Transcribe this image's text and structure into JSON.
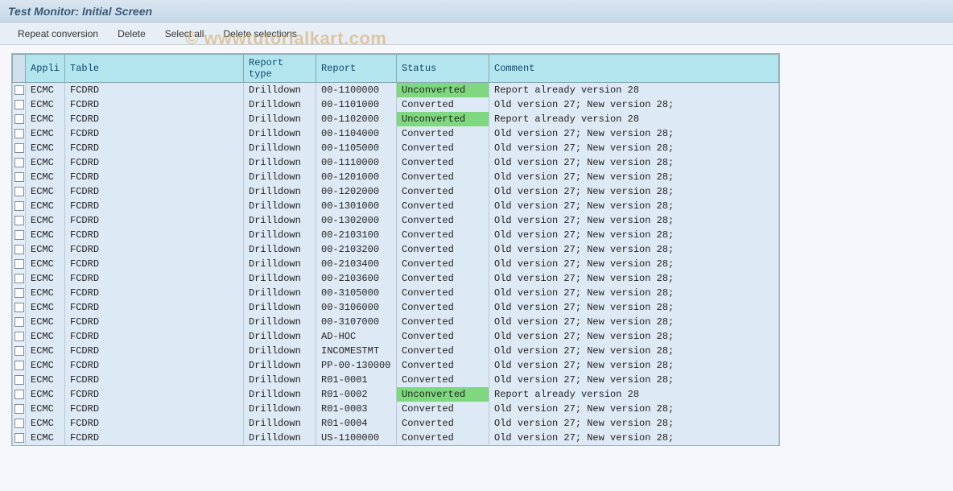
{
  "title": "Test Monitor: Initial Screen",
  "toolbar": {
    "repeat": "Repeat conversion",
    "delete": "Delete",
    "selectall": "Select all",
    "delsel": "Delete selections"
  },
  "watermark": "© wwwtutorialkart.com",
  "columns": {
    "appli": "Appli",
    "table": "Table",
    "reptype": "Report type",
    "report": "Report",
    "status": "Status",
    "comment": "Comment"
  },
  "rows": [
    {
      "appli": "ECMC",
      "table": "FCDRD",
      "reptype": "Drilldown",
      "report": "00-1100000",
      "status": "Unconverted",
      "comment": "Report already version 28"
    },
    {
      "appli": "ECMC",
      "table": "FCDRD",
      "reptype": "Drilldown",
      "report": "00-1101000",
      "status": "Converted",
      "comment": "Old version 27; New version 28;"
    },
    {
      "appli": "ECMC",
      "table": "FCDRD",
      "reptype": "Drilldown",
      "report": "00-1102000",
      "status": "Unconverted",
      "comment": "Report already version 28"
    },
    {
      "appli": "ECMC",
      "table": "FCDRD",
      "reptype": "Drilldown",
      "report": "00-1104000",
      "status": "Converted",
      "comment": "Old version 27; New version 28;"
    },
    {
      "appli": "ECMC",
      "table": "FCDRD",
      "reptype": "Drilldown",
      "report": "00-1105000",
      "status": "Converted",
      "comment": "Old version 27; New version 28;"
    },
    {
      "appli": "ECMC",
      "table": "FCDRD",
      "reptype": "Drilldown",
      "report": "00-1110000",
      "status": "Converted",
      "comment": "Old version 27; New version 28;"
    },
    {
      "appli": "ECMC",
      "table": "FCDRD",
      "reptype": "Drilldown",
      "report": "00-1201000",
      "status": "Converted",
      "comment": "Old version 27; New version 28;"
    },
    {
      "appli": "ECMC",
      "table": "FCDRD",
      "reptype": "Drilldown",
      "report": "00-1202000",
      "status": "Converted",
      "comment": "Old version 27; New version 28;"
    },
    {
      "appli": "ECMC",
      "table": "FCDRD",
      "reptype": "Drilldown",
      "report": "00-1301000",
      "status": "Converted",
      "comment": "Old version 27; New version 28;"
    },
    {
      "appli": "ECMC",
      "table": "FCDRD",
      "reptype": "Drilldown",
      "report": "00-1302000",
      "status": "Converted",
      "comment": "Old version 27; New version 28;"
    },
    {
      "appli": "ECMC",
      "table": "FCDRD",
      "reptype": "Drilldown",
      "report": "00-2103100",
      "status": "Converted",
      "comment": "Old version 27; New version 28;"
    },
    {
      "appli": "ECMC",
      "table": "FCDRD",
      "reptype": "Drilldown",
      "report": "00-2103200",
      "status": "Converted",
      "comment": "Old version 27; New version 28;"
    },
    {
      "appli": "ECMC",
      "table": "FCDRD",
      "reptype": "Drilldown",
      "report": "00-2103400",
      "status": "Converted",
      "comment": "Old version 27; New version 28;"
    },
    {
      "appli": "ECMC",
      "table": "FCDRD",
      "reptype": "Drilldown",
      "report": "00-2103600",
      "status": "Converted",
      "comment": "Old version 27; New version 28;"
    },
    {
      "appli": "ECMC",
      "table": "FCDRD",
      "reptype": "Drilldown",
      "report": "00-3105000",
      "status": "Converted",
      "comment": "Old version 27; New version 28;"
    },
    {
      "appli": "ECMC",
      "table": "FCDRD",
      "reptype": "Drilldown",
      "report": "00-3106000",
      "status": "Converted",
      "comment": "Old version 27; New version 28;"
    },
    {
      "appli": "ECMC",
      "table": "FCDRD",
      "reptype": "Drilldown",
      "report": "00-3107000",
      "status": "Converted",
      "comment": "Old version 27; New version 28;"
    },
    {
      "appli": "ECMC",
      "table": "FCDRD",
      "reptype": "Drilldown",
      "report": "AD-HOC",
      "status": "Converted",
      "comment": "Old version 27; New version 28;"
    },
    {
      "appli": "ECMC",
      "table": "FCDRD",
      "reptype": "Drilldown",
      "report": "INCOMESTMT",
      "status": "Converted",
      "comment": "Old version 27; New version 28;"
    },
    {
      "appli": "ECMC",
      "table": "FCDRD",
      "reptype": "Drilldown",
      "report": "PP-00-130000",
      "status": "Converted",
      "comment": "Old version 27; New version 28;"
    },
    {
      "appli": "ECMC",
      "table": "FCDRD",
      "reptype": "Drilldown",
      "report": "R01-0001",
      "status": "Converted",
      "comment": "Old version 27; New version 28;"
    },
    {
      "appli": "ECMC",
      "table": "FCDRD",
      "reptype": "Drilldown",
      "report": "R01-0002",
      "status": "Unconverted",
      "comment": "Report already version 28"
    },
    {
      "appli": "ECMC",
      "table": "FCDRD",
      "reptype": "Drilldown",
      "report": "R01-0003",
      "status": "Converted",
      "comment": "Old version 27; New version 28;"
    },
    {
      "appli": "ECMC",
      "table": "FCDRD",
      "reptype": "Drilldown",
      "report": "R01-0004",
      "status": "Converted",
      "comment": "Old version 27; New version 28;"
    },
    {
      "appli": "ECMC",
      "table": "FCDRD",
      "reptype": "Drilldown",
      "report": "US-1100000",
      "status": "Converted",
      "comment": "Old version 27; New version 28;"
    }
  ]
}
